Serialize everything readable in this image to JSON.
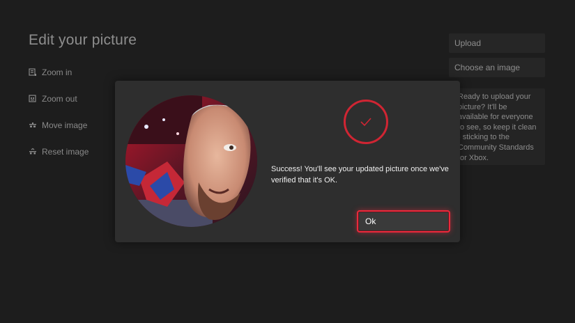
{
  "page": {
    "title": "Edit your picture"
  },
  "tools": [
    {
      "label": "Zoom in",
      "icon": "zoom-in-icon"
    },
    {
      "label": "Zoom out",
      "icon": "zoom-out-icon"
    },
    {
      "label": "Move image",
      "icon": "move-image-icon"
    },
    {
      "label": "Reset image",
      "icon": "reset-image-icon"
    }
  ],
  "side_panel": {
    "upload_label": "Upload",
    "choose_label": "Choose an image",
    "info_text": "Ready to upload your picture? It'll be available for everyone to see, so keep it clean - sticking to the Community Standards for Xbox."
  },
  "dialog": {
    "status_icon": "checkmark-icon",
    "message": "Success! You'll see your updated picture once we've verified that it's OK.",
    "ok_label": "Ok"
  },
  "colors": {
    "background": "#1d1d1d",
    "dialog": "#2e2e2e",
    "accent_red": "#d02533",
    "focus_red": "#ea2a3c"
  }
}
